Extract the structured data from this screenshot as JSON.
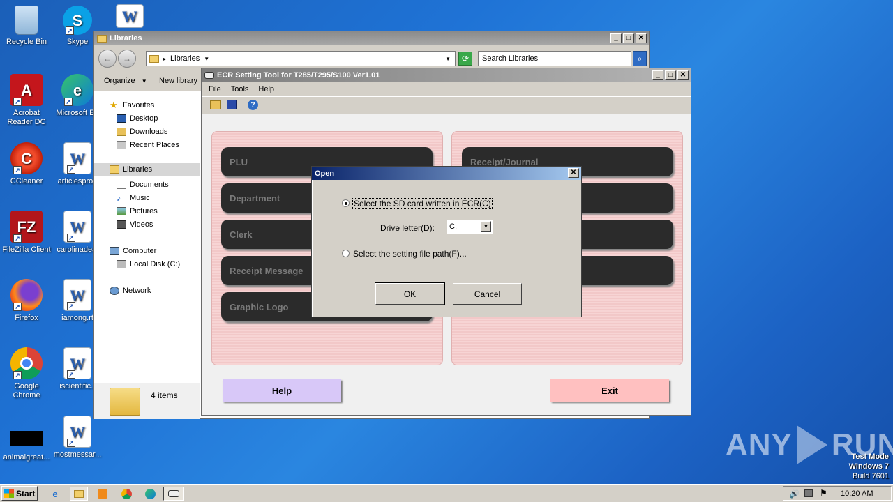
{
  "desktop": {
    "icons": [
      {
        "label": "Recycle Bin"
      },
      {
        "label": "Skype"
      },
      {
        "label": "Acrobat Reader DC"
      },
      {
        "label": "Microsoft Ed"
      },
      {
        "label": "CCleaner"
      },
      {
        "label": "articlesprob"
      },
      {
        "label": "FileZilla Client"
      },
      {
        "label": "carolinadeal"
      },
      {
        "label": "Firefox"
      },
      {
        "label": "iamong.rt"
      },
      {
        "label": "Google Chrome"
      },
      {
        "label": "iscientific.r"
      },
      {
        "label": "animalgreat..."
      },
      {
        "label": "mostmessar..."
      }
    ],
    "watermark": {
      "text": "ANY RUN",
      "left": "ANY",
      "right": "RUN"
    },
    "os_info": {
      "line1": "Test Mode",
      "line2": "Windows 7",
      "line3": "Build 7601"
    }
  },
  "explorer": {
    "title": "Libraries",
    "address": "Libraries",
    "search_placeholder": "Search Libraries",
    "toolbar": {
      "organize": "Organize",
      "new_library": "New library"
    },
    "nav": {
      "favorites": "Favorites",
      "desktop": "Desktop",
      "downloads": "Downloads",
      "recent": "Recent Places",
      "libraries": "Libraries",
      "documents": "Documents",
      "music": "Music",
      "pictures": "Pictures",
      "videos": "Videos",
      "computer": "Computer",
      "local_disk": "Local Disk (C:)",
      "network": "Network"
    },
    "status": "4 items"
  },
  "ecr": {
    "title": "ECR Setting Tool for T285/T295/S100 Ver1.01",
    "menu": {
      "file": "File",
      "tools": "Tools",
      "help": "Help"
    },
    "left_buttons": [
      "PLU",
      "Department",
      "Clerk",
      "Receipt Message",
      "Graphic Logo"
    ],
    "right_buttons": [
      "Receipt/Journal",
      "",
      "",
      ""
    ],
    "help_label": "Help",
    "exit_label": "Exit",
    "colors": {
      "help": "#d8c8f8",
      "exit": "#ffc0c0",
      "panel": "#f7d4d4"
    }
  },
  "dialog": {
    "title": "Open",
    "option1": "Select the SD card written in ECR(C)",
    "drive_label": "Drive letter(D):",
    "drive_value": "C:",
    "option2": "Select the setting file path(F)...",
    "ok": "OK",
    "cancel": "Cancel",
    "selected_option": 1
  },
  "taskbar": {
    "start": "Start",
    "time": "10:20 AM"
  }
}
